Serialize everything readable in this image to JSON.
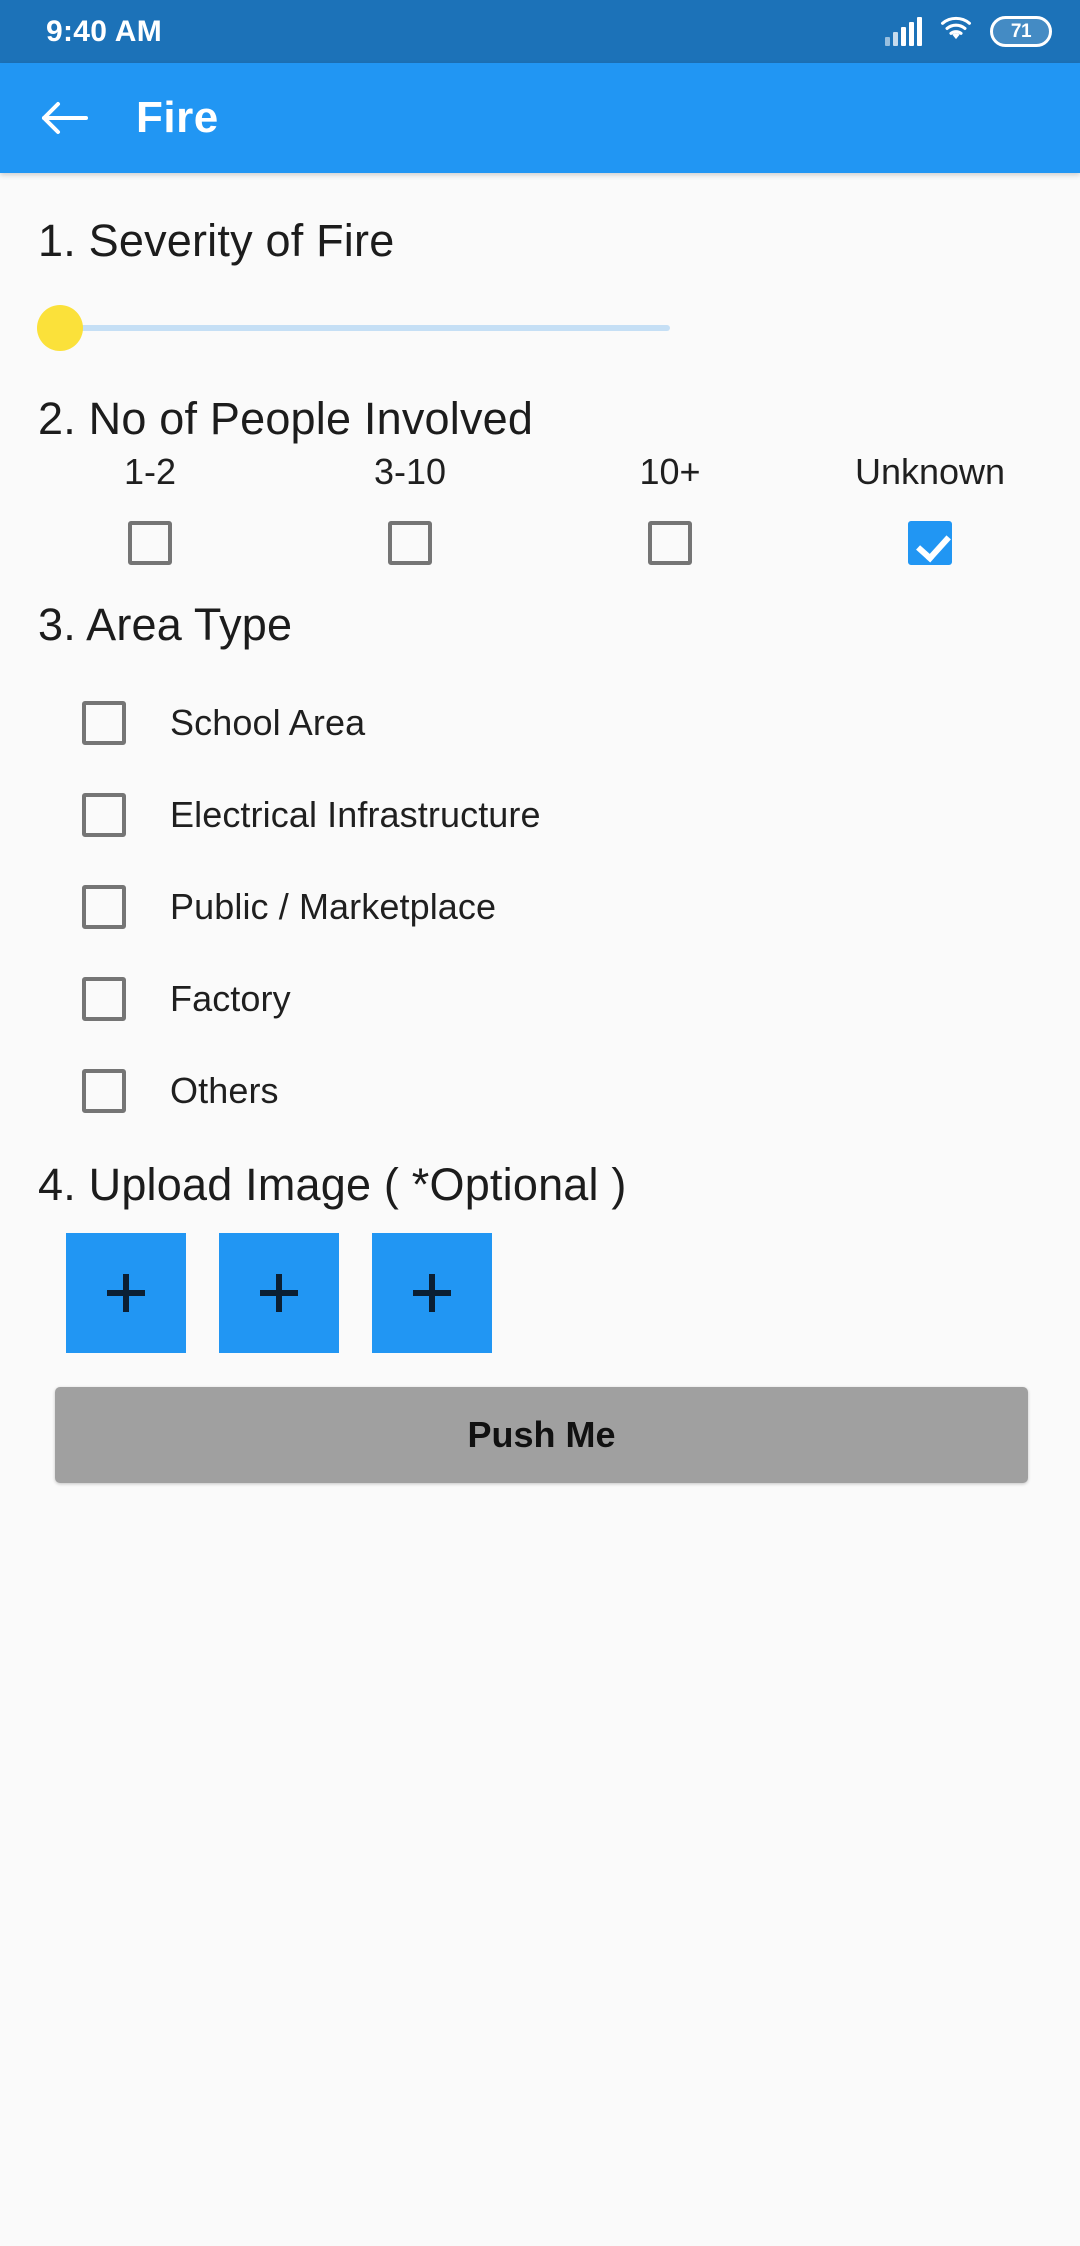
{
  "status_bar": {
    "time": "9:40 AM",
    "signal_icon": "signal-bars-icon",
    "wifi_icon": "wifi-icon",
    "battery_level": "71"
  },
  "app_bar": {
    "back_icon": "back-arrow-icon",
    "title": "Fire"
  },
  "colors": {
    "status_bar": "#1C72B8",
    "app_bar": "#2196F3",
    "accent": "#2196F3",
    "slider_thumb": "#FBE13A",
    "slider_track": "#C5DFF5",
    "page_background": "#FAFAFA",
    "submit_button": "#A0A0A0",
    "checkbox_border": "#757575"
  },
  "form": {
    "severity": {
      "title": "1. Severity of Fire",
      "value": 0,
      "min": 0,
      "max": 100
    },
    "people": {
      "title": "2. No of People Involved",
      "options": [
        {
          "label": "1-2",
          "checked": false
        },
        {
          "label": "3-10",
          "checked": false
        },
        {
          "label": "10+",
          "checked": false
        },
        {
          "label": "Unknown",
          "checked": true
        }
      ]
    },
    "area_type": {
      "title": "3. Area Type",
      "options": [
        {
          "label": "School Area",
          "checked": false
        },
        {
          "label": "Electrical Infrastructure",
          "checked": false
        },
        {
          "label": "Public / Marketplace",
          "checked": false
        },
        {
          "label": "Factory",
          "checked": false
        },
        {
          "label": "Others",
          "checked": false
        }
      ]
    },
    "upload": {
      "title": "4. Upload Image ( *Optional )",
      "tiles": [
        {
          "icon": "plus-icon"
        },
        {
          "icon": "plus-icon"
        },
        {
          "icon": "plus-icon"
        }
      ]
    },
    "submit": {
      "label": "Push Me"
    }
  }
}
